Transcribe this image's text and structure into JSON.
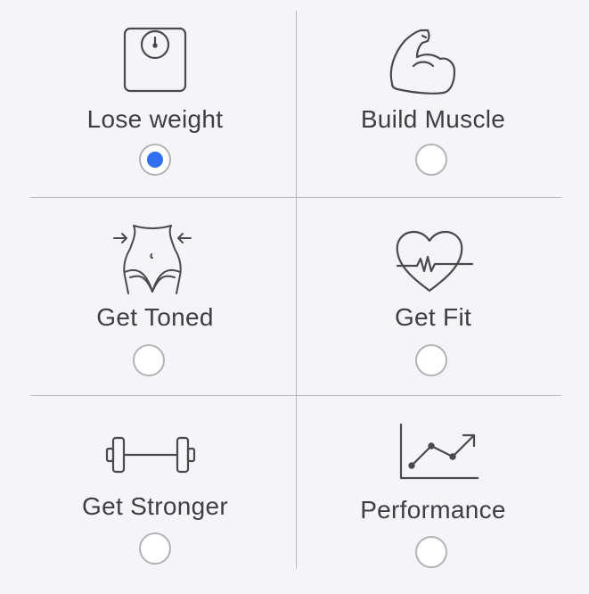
{
  "goals": [
    {
      "id": "lose-weight",
      "label": "Lose weight",
      "icon": "scale-icon",
      "selected": true
    },
    {
      "id": "build-muscle",
      "label": "Build Muscle",
      "icon": "flexed-arm-icon",
      "selected": false
    },
    {
      "id": "get-toned",
      "label": "Get Toned",
      "icon": "waist-icon",
      "selected": false
    },
    {
      "id": "get-fit",
      "label": "Get Fit",
      "icon": "heartbeat-icon",
      "selected": false
    },
    {
      "id": "get-stronger",
      "label": "Get Stronger",
      "icon": "dumbbell-icon",
      "selected": false
    },
    {
      "id": "performance",
      "label": "Performance",
      "icon": "line-chart-icon",
      "selected": false
    }
  ],
  "colors": {
    "selected": "#2f6ff0",
    "divider": "#b9b9bd",
    "text": "#3f3f41",
    "background": "#f5f5f7",
    "icon": "#4a4a4c"
  }
}
